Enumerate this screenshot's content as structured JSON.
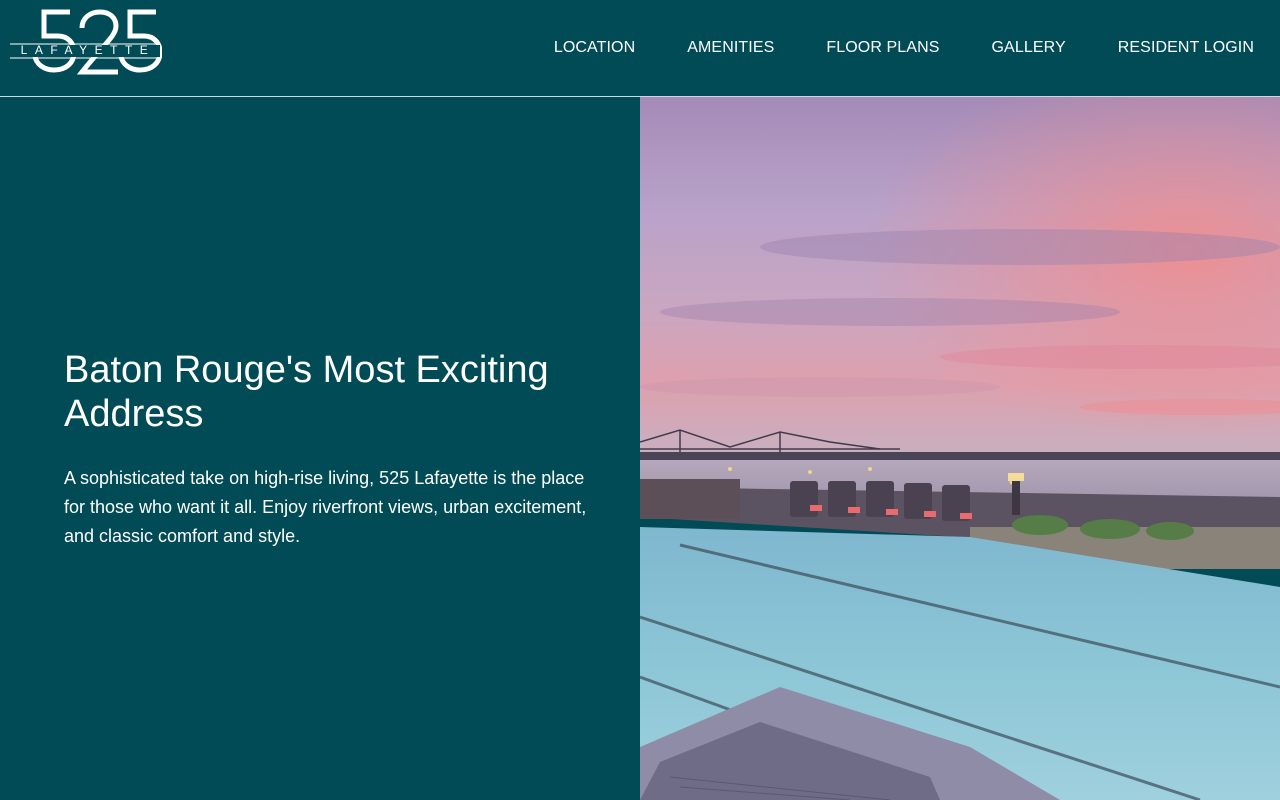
{
  "brand": {
    "number": "525",
    "name": "LAFAYETTE"
  },
  "nav": [
    {
      "label": "LOCATION"
    },
    {
      "label": "AMENITIES"
    },
    {
      "label": "FLOOR PLANS"
    },
    {
      "label": "GALLERY"
    },
    {
      "label": "RESIDENT LOGIN"
    }
  ],
  "hero": {
    "title": "Baton Rouge's Most Exciting Address",
    "description": "A sophisticated take on high-rise living, 525 Lafayette is the place for those who want it all. Enjoy riverfront views, urban excitement, and classic comfort and style."
  },
  "colors": {
    "brand_teal": "#004b55",
    "text": "#ffffff"
  }
}
